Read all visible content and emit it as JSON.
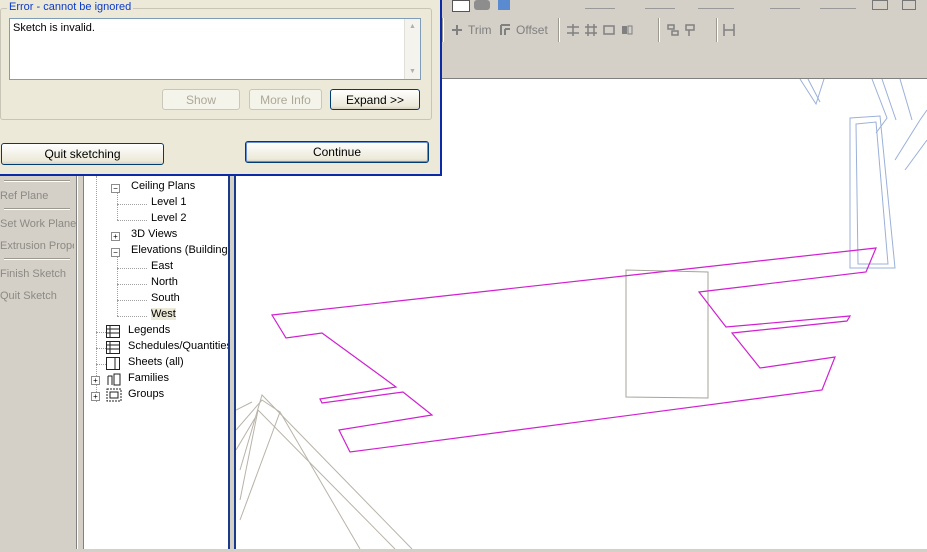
{
  "dialog": {
    "group_title": "Error - cannot be ignored",
    "message": "Sketch is invalid.",
    "buttons": {
      "show": "Show",
      "more_info": "More Info",
      "expand": "Expand >>",
      "quit_sketching": "Quit sketching",
      "continue": "Continue"
    }
  },
  "toolbar": {
    "trim_label": "Trim",
    "offset_label": "Offset"
  },
  "design_bar": {
    "items": [
      "Ref Plane",
      "Set Work Plane",
      "Extrusion Properties",
      "Finish Sketch",
      "Quit Sketch"
    ]
  },
  "project_browser": {
    "ceiling_plans": "Ceiling Plans",
    "level1": "Level 1",
    "level2": "Level 2",
    "views_3d": "3D Views",
    "elevations": "Elevations (Building Elevation)",
    "east": "East",
    "north": "North",
    "south": "South",
    "west": "West",
    "legends": "Legends",
    "schedules": "Schedules/Quantities",
    "sheets": "Sheets (all)",
    "families": "Families",
    "groups": "Groups"
  },
  "colors": {
    "sketch_line": "#d020d0",
    "dialog_border": "#0a2aa8",
    "group_title": "#0c3ac8"
  }
}
